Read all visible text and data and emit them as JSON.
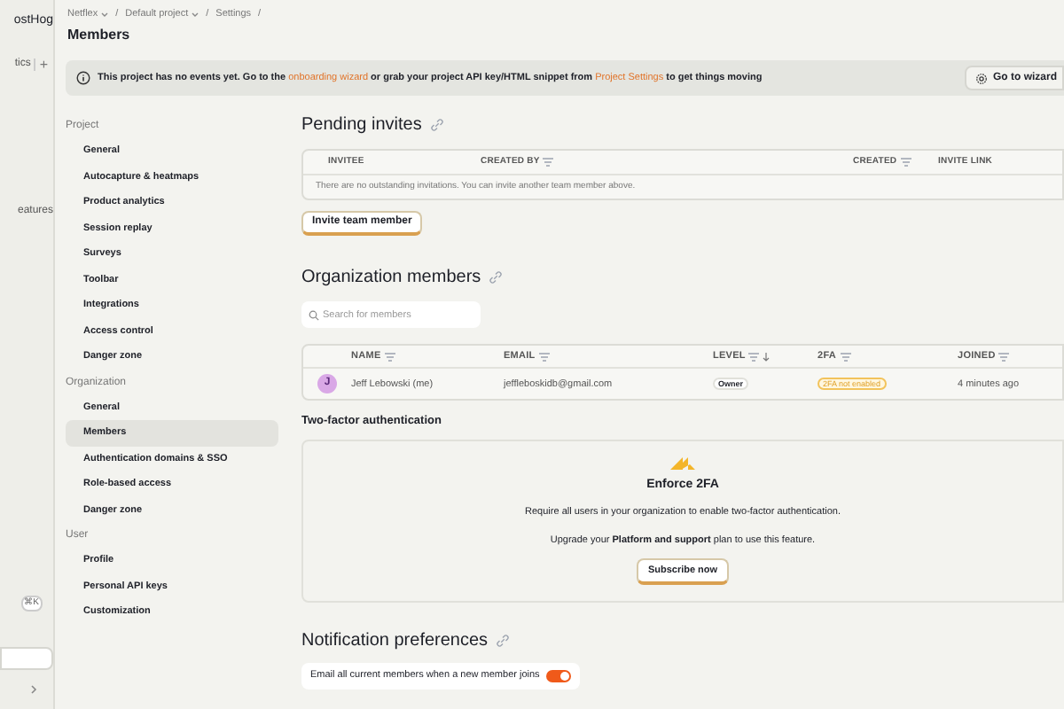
{
  "left_rail": {
    "logo_text": "ostHog",
    "nav_item": "tics",
    "nav_add": "+",
    "nav_item_2": "eatures",
    "shortcut": "⌘K"
  },
  "breadcrumbs": [
    {
      "label": "Netflex",
      "dropdown": true,
      "separator": "/"
    },
    {
      "label": "Default project",
      "dropdown": true,
      "separator": "/"
    },
    {
      "label": "Settings",
      "dropdown": false,
      "separator": "/"
    }
  ],
  "page_title": "Members",
  "banner": {
    "parts": [
      {
        "text": "This project has no events yet. Go to the ",
        "kind": "text"
      },
      {
        "text": "onboarding wizard",
        "kind": "link"
      },
      {
        "text": " or grab your project API key/HTML snippet from ",
        "kind": "text"
      },
      {
        "text": "Project Settings",
        "kind": "link"
      },
      {
        "text": " to get things moving",
        "kind": "text"
      }
    ],
    "button": "Go to wizard"
  },
  "settings_nav": [
    {
      "heading": "Project",
      "items": [
        {
          "label": "General",
          "selected": false
        },
        {
          "label": "Autocapture & heatmaps",
          "selected": false
        },
        {
          "label": "Product analytics",
          "selected": false
        },
        {
          "label": "Session replay",
          "selected": false
        },
        {
          "label": "Surveys",
          "selected": false
        },
        {
          "label": "Toolbar",
          "selected": false
        },
        {
          "label": "Integrations",
          "selected": false
        },
        {
          "label": "Access control",
          "selected": false
        },
        {
          "label": "Danger zone",
          "selected": false
        }
      ]
    },
    {
      "heading": "Organization",
      "items": [
        {
          "label": "General",
          "selected": false
        },
        {
          "label": "Members",
          "selected": true
        },
        {
          "label": "Authentication domains & SSO",
          "selected": false
        },
        {
          "label": "Role-based access",
          "selected": false
        },
        {
          "label": "Danger zone",
          "selected": false
        }
      ]
    },
    {
      "heading": "User",
      "items": [
        {
          "label": "Profile",
          "selected": false
        },
        {
          "label": "Personal API keys",
          "selected": false
        },
        {
          "label": "Customization",
          "selected": false
        }
      ]
    }
  ],
  "pending_invites": {
    "title": "Pending invites",
    "columns": [
      {
        "label": "INVITEE",
        "sortable": false
      },
      {
        "label": "CREATED BY",
        "sortable": true
      },
      {
        "label": "CREATED",
        "sortable": true
      },
      {
        "label": "INVITE LINK",
        "sortable": false
      }
    ],
    "empty_text": "There are no outstanding invitations. You can invite another team member above.",
    "button": "Invite team member"
  },
  "organization_members": {
    "title": "Organization members",
    "search_placeholder": "Search for members",
    "columns": [
      {
        "label": "NAME",
        "sorted": false
      },
      {
        "label": "EMAIL",
        "sorted": false
      },
      {
        "label": "LEVEL",
        "sorted": true
      },
      {
        "label": "2FA",
        "sorted": false
      },
      {
        "label": "JOINED",
        "sorted": false
      }
    ],
    "rows": [
      {
        "avatar": "J",
        "name": "Jeff Lebowski (me)",
        "email": "jeffleboskidb@gmail.com",
        "level": "Owner",
        "twofa": "2FA not enabled",
        "joined": "4 minutes ago"
      }
    ]
  },
  "two_factor": {
    "section_title": "Two-factor authentication",
    "title": "Enforce 2FA",
    "description": "Require all users in your organization to enable two-factor authentication.",
    "upgrade_text": "Upgrade your **Platform and support** plan to use this feature.",
    "button": "Subscribe now"
  },
  "notification_preferences": {
    "title": "Notification preferences",
    "toggle_label": "Email all current members when a new member joins",
    "on": true
  }
}
